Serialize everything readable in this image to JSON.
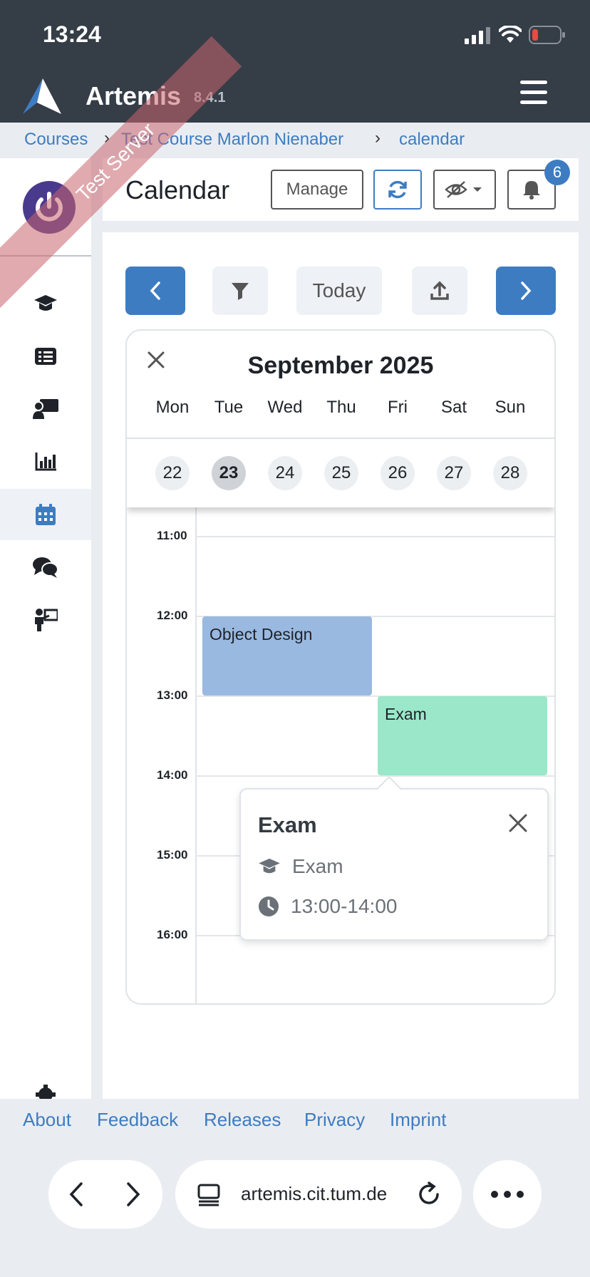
{
  "status_bar": {
    "time": "13:24"
  },
  "header": {
    "brand": "Artemis",
    "version": "8.4.1",
    "ribbon": "Test Server"
  },
  "breadcrumb": {
    "items": [
      "Courses",
      "Test Course Marlon Nienaber",
      "calendar"
    ]
  },
  "page": {
    "title": "Calendar",
    "manage_label": "Manage",
    "notification_count": "6"
  },
  "navigation": {
    "today_label": "Today"
  },
  "calendar": {
    "month_title": "September 2025",
    "weekdays": [
      "Mon",
      "Tue",
      "Wed",
      "Thu",
      "Fri",
      "Sat",
      "Sun"
    ],
    "days": [
      "22",
      "23",
      "24",
      "25",
      "26",
      "27",
      "28"
    ],
    "selected_day": "23",
    "hours": [
      "11:00",
      "12:00",
      "13:00",
      "14:00",
      "15:00",
      "16:00"
    ],
    "events": [
      {
        "title": "Object Design",
        "color": "#9ab9e0"
      },
      {
        "title": "Exam",
        "color": "#9ae8c9"
      }
    ]
  },
  "popover": {
    "title": "Exam",
    "type": "Exam",
    "time": "13:00-14:00"
  },
  "footer": {
    "links": [
      "About",
      "Feedback",
      "Releases",
      "Privacy",
      "Imprint"
    ]
  },
  "browser": {
    "url": "artemis.cit.tum.de"
  },
  "colors": {
    "primary": "#3e7cc2",
    "header_bg": "#353d47",
    "ribbon": "#c8646e"
  }
}
